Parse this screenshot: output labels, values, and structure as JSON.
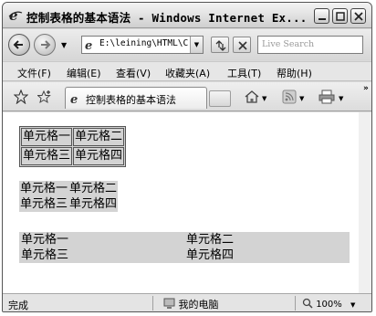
{
  "window": {
    "title": "控制表格的基本语法 - Windows Internet Ex..."
  },
  "address_bar": {
    "url": "E:\\leining\\HTML\\C",
    "search_placeholder": "Live Search"
  },
  "menu": {
    "items": [
      "文件(F)",
      "编辑(E)",
      "查看(V)",
      "收藏夹(A)",
      "工具(T)",
      "帮助(H)"
    ]
  },
  "tab": {
    "label": "控制表格的基本语法"
  },
  "page": {
    "table_bordered": [
      [
        "单元格一",
        "单元格二"
      ],
      [
        "单元格三",
        "单元格四"
      ]
    ],
    "table_compact": [
      [
        "单元格一",
        "单元格二"
      ],
      [
        "单元格三",
        "单元格四"
      ]
    ],
    "table_wide": [
      [
        "单元格一",
        "单元格二"
      ],
      [
        "单元格三",
        "单元格四"
      ]
    ]
  },
  "status": {
    "text": "完成",
    "zone": "我的电脑",
    "zoom": "100%"
  },
  "icons": {
    "back": "back-arrow-icon",
    "forward": "forward-arrow-icon",
    "page": "ie-page-icon",
    "refresh": "refresh-icon",
    "stop": "stop-icon",
    "favorites": "favorites-star-icon",
    "add_favorites": "add-favorites-icon",
    "home": "home-icon",
    "feeds": "feeds-icon",
    "print": "print-icon",
    "computer": "computer-icon",
    "zoom": "magnifier-icon"
  },
  "colors": {
    "table_background": "#d3d3d3",
    "chrome": "#d9d9d9"
  }
}
